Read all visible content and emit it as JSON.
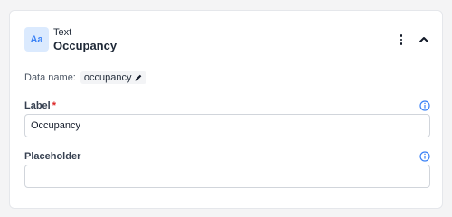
{
  "field": {
    "type_icon_text": "Aa",
    "type_label": "Text",
    "name": "Occupancy"
  },
  "menu_icon": "kebab-menu-icon",
  "collapse_icon": "chevron-up-icon",
  "data_name": {
    "label": "Data name:",
    "value": "occupancy",
    "edit_icon": "pencil-icon"
  },
  "label_field": {
    "label": "Label",
    "required_mark": "*",
    "value": "Occupancy",
    "info_icon": "info-icon"
  },
  "placeholder_field": {
    "label": "Placeholder",
    "value": "",
    "info_icon": "info-icon"
  },
  "colors": {
    "accent": "#3b82f6",
    "required": "#dc2626",
    "icon_bg": "#dbeafe"
  }
}
